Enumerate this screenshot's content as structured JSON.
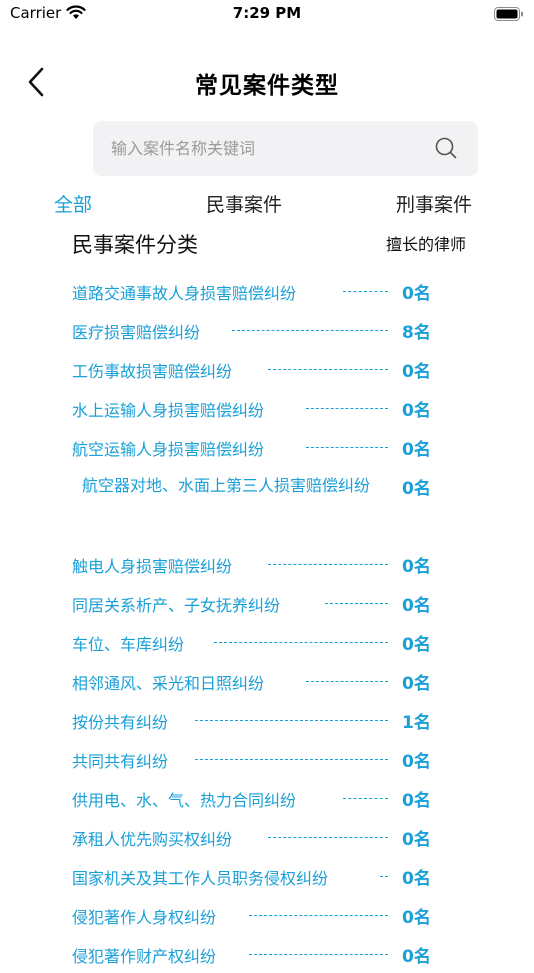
{
  "status_bar": {
    "carrier": "Carrier",
    "time": "7:29 PM"
  },
  "header": {
    "title": "常见案件类型"
  },
  "search": {
    "placeholder": "输入案件名称关键词",
    "value": ""
  },
  "tabs": [
    {
      "label": "全部",
      "active": true
    },
    {
      "label": "民事案件",
      "active": false
    },
    {
      "label": "刑事案件",
      "active": false
    }
  ],
  "section": {
    "title": "民事案件分类",
    "column_label": "擅长的律师"
  },
  "colors": {
    "accent": "#1aa0d8"
  },
  "items": [
    {
      "name": "道路交通事故人身损害赔偿纠纷",
      "count": "0名"
    },
    {
      "name": "医疗损害赔偿纠纷",
      "count": "8名"
    },
    {
      "name": "工伤事故损害赔偿纠纷",
      "count": "0名"
    },
    {
      "name": "水上运输人身损害赔偿纠纷",
      "count": "0名"
    },
    {
      "name": "航空运输人身损害赔偿纠纷",
      "count": "0名"
    },
    {
      "name": "航空器对地、水面上第三人损害赔偿纠纷",
      "count": "0名"
    },
    {
      "name": "触电人身损害赔偿纠纷",
      "count": "0名"
    },
    {
      "name": "同居关系析产、子女抚养纠纷",
      "count": "0名"
    },
    {
      "name": "车位、车库纠纷",
      "count": "0名"
    },
    {
      "name": "相邻通风、采光和日照纠纷",
      "count": "0名"
    },
    {
      "name": "按份共有纠纷",
      "count": "1名"
    },
    {
      "name": "共同共有纠纷",
      "count": "0名"
    },
    {
      "name": "供用电、水、气、热力合同纠纷",
      "count": "0名"
    },
    {
      "name": "承租人优先购买权纠纷",
      "count": "0名"
    },
    {
      "name": "国家机关及其工作人员职务侵权纠纷",
      "count": "0名"
    },
    {
      "name": "侵犯著作人身权纠纷",
      "count": "0名"
    },
    {
      "name": "侵犯著作财产权纠纷",
      "count": "0名"
    }
  ]
}
